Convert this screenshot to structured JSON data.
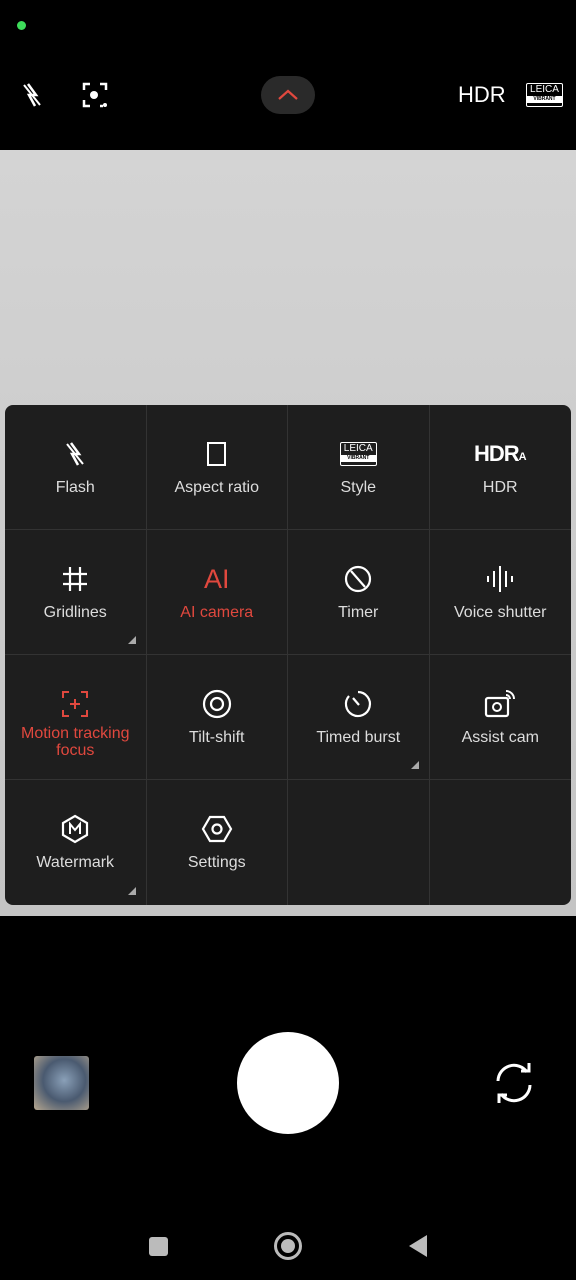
{
  "status": {
    "indicator_color": "#3ddc5a"
  },
  "topbar": {
    "flash_icon": "flash-off-icon",
    "focus_icon": "focus-icon",
    "expand_icon": "chevron-up-icon",
    "hdr_label": "HDR",
    "leica_text": "LEICA",
    "leica_sub": "VIBRANT"
  },
  "panel": {
    "items": [
      {
        "label": "Flash",
        "icon": "flash-off-icon"
      },
      {
        "label": "Aspect ratio",
        "icon": "aspect-ratio-icon"
      },
      {
        "label": "Style",
        "icon": "leica-style-icon",
        "badge_text": "LEICA",
        "badge_sub": "VIBRANT"
      },
      {
        "label": "HDR",
        "icon": "hdr-auto-icon",
        "icon_text": "HDR",
        "icon_sub": "A"
      },
      {
        "label": "Gridlines",
        "icon": "grid-icon",
        "has_submenu": true
      },
      {
        "label": "AI camera",
        "icon": "ai-icon",
        "icon_text": "AI",
        "active": true
      },
      {
        "label": "Timer",
        "icon": "timer-off-icon"
      },
      {
        "label": "Voice shutter",
        "icon": "voice-icon"
      },
      {
        "label": "Motion tracking focus",
        "icon": "motion-focus-icon",
        "active": true
      },
      {
        "label": "Tilt-shift",
        "icon": "tilt-shift-icon"
      },
      {
        "label": "Timed burst",
        "icon": "timed-burst-icon",
        "has_submenu": true
      },
      {
        "label": "Assist cam",
        "icon": "assist-cam-icon"
      },
      {
        "label": "Watermark",
        "icon": "watermark-icon",
        "has_submenu": true
      },
      {
        "label": "Settings",
        "icon": "settings-icon"
      }
    ]
  },
  "colors": {
    "accent": "#e0483e",
    "panel": "#1e1e1e"
  }
}
